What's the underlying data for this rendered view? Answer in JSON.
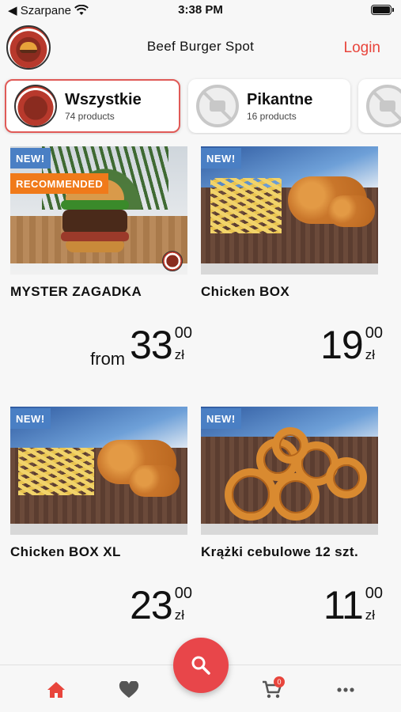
{
  "status_bar": {
    "back_app": "◀ Szarpane",
    "time": "3:38 PM"
  },
  "header": {
    "title": "Beef Burger Spot",
    "login_label": "Login"
  },
  "categories": [
    {
      "name": "Wszystkie",
      "count": "74 products",
      "active": true
    },
    {
      "name": "Pikantne",
      "count": "16 products",
      "active": false
    },
    {
      "name": "",
      "count": "",
      "active": false
    }
  ],
  "products": [
    {
      "name": "MYSTER ZAGADKA",
      "badges": [
        "NEW!",
        "RECOMMENDED"
      ],
      "price_prefix": "from",
      "price_int": "33",
      "price_dec": "00",
      "currency": "zł"
    },
    {
      "name": "Chicken BOX",
      "badges": [
        "NEW!"
      ],
      "price_prefix": "",
      "price_int": "19",
      "price_dec": "00",
      "currency": "zł"
    },
    {
      "name": "Chicken BOX XL",
      "badges": [
        "NEW!"
      ],
      "price_prefix": "",
      "price_int": "23",
      "price_dec": "00",
      "currency": "zł"
    },
    {
      "name": "Krążki cebulowe 12 szt.",
      "badges": [
        "NEW!"
      ],
      "price_prefix": "",
      "price_int": "11",
      "price_dec": "00",
      "currency": "zł"
    }
  ],
  "bottom_nav": {
    "items": [
      "home-icon",
      "heart-icon",
      "search-icon",
      "cart-icon",
      "more-icon"
    ],
    "cart_count": "0"
  },
  "colors": {
    "accent": "#e8453c",
    "new_badge": "#4a7fc4",
    "recommended_badge": "#f07a1a"
  }
}
